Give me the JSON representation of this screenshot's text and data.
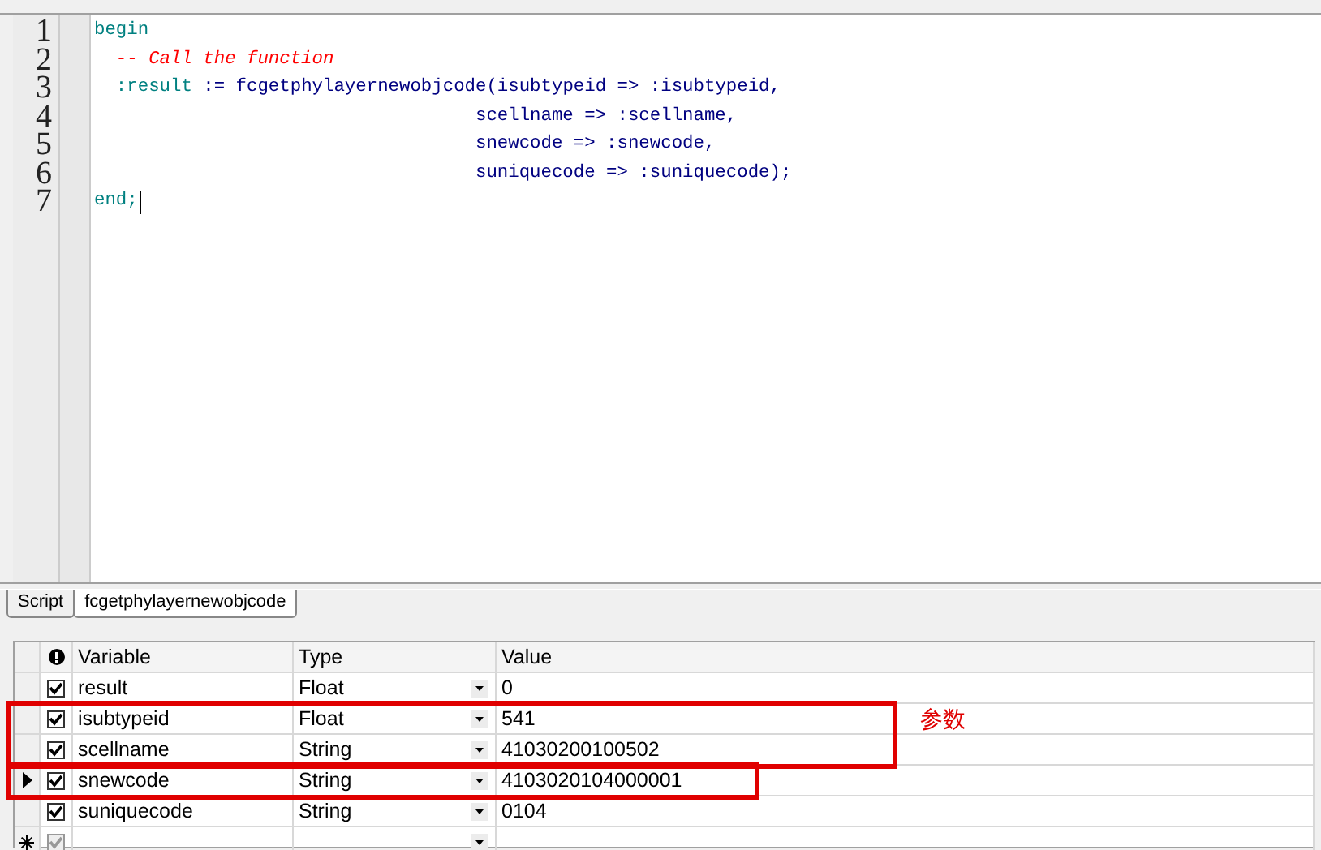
{
  "editor": {
    "lines": [
      [
        {
          "kind": "keyword",
          "text": "begin"
        }
      ],
      [
        {
          "kind": "comment",
          "text": "  -- Call the function"
        }
      ],
      [
        {
          "kind": "keyword",
          "text": "  :result"
        },
        {
          "kind": "plain",
          "text": " := fcgetphylayernewobjcode(isubtypeid => :isubtypeid,"
        }
      ],
      [
        {
          "kind": "plain",
          "text": "                                   scellname => :scellname,"
        }
      ],
      [
        {
          "kind": "plain",
          "text": "                                   snewcode => :snewcode,"
        }
      ],
      [
        {
          "kind": "plain",
          "text": "                                   suniquecode => :suniquecode);"
        }
      ],
      [
        {
          "kind": "keyword",
          "text": "end;"
        }
      ]
    ],
    "line_numbers": [
      "1",
      "2",
      "3",
      "4",
      "5",
      "6",
      "7"
    ]
  },
  "tabs": [
    {
      "label": "Script",
      "selected": false
    },
    {
      "label": "fcgetphylayernewobjcode",
      "selected": true
    }
  ],
  "grid": {
    "columns": [
      "Variable",
      "Type",
      "Value"
    ],
    "rows": [
      {
        "kind": "row",
        "current": false,
        "checked": true,
        "variable": "result",
        "type": "Float",
        "value": "0"
      },
      {
        "kind": "outline",
        "note": "参数",
        "rows": [
          {
            "kind": "row",
            "current": false,
            "checked": true,
            "variable": "isubtypeid",
            "type": "Float",
            "value": "541"
          },
          {
            "kind": "row",
            "current": false,
            "checked": true,
            "variable": "scellname",
            "type": "String",
            "value": "41030200100502"
          }
        ]
      },
      {
        "kind": "outline",
        "rows": [
          {
            "kind": "row",
            "current": true,
            "checked": true,
            "variable": "snewcode",
            "type": "String",
            "value": "4103020104000001"
          }
        ]
      },
      {
        "kind": "row",
        "current": false,
        "checked": true,
        "variable": "suniquecode",
        "type": "String",
        "value": "0104"
      }
    ],
    "new_row": {
      "checked": true,
      "disabled": true
    }
  }
}
